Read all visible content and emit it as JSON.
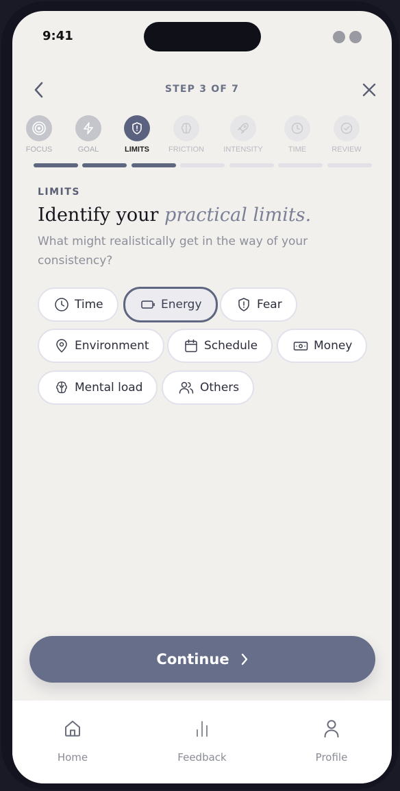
{
  "status_bar": {
    "time": "9:41"
  },
  "header": {
    "step_text": "STEP 3 OF 7"
  },
  "steps": [
    {
      "label": "FOCUS",
      "state": "done",
      "icon": "target-icon"
    },
    {
      "label": "GOAL",
      "state": "done",
      "icon": "bolt-icon"
    },
    {
      "label": "LIMITS",
      "state": "active",
      "icon": "shield-alert-icon"
    },
    {
      "label": "FRICTION",
      "state": "todo",
      "icon": "brain-icon"
    },
    {
      "label": "INTENSITY",
      "state": "todo",
      "icon": "rocket-icon"
    },
    {
      "label": "TIME",
      "state": "todo",
      "icon": "clock-icon"
    },
    {
      "label": "REVIEW",
      "state": "todo",
      "icon": "check-circle-icon"
    }
  ],
  "progress": {
    "completed_segments": 3,
    "total_segments": 7
  },
  "content": {
    "eyebrow": "LIMITS",
    "headline_plain": "Identify your",
    "headline_emphasis": "practical limits.",
    "subtitle": "What might realistically get in the way of your consistency?"
  },
  "chips": [
    {
      "label": "Time",
      "icon": "clock-icon",
      "selected": false
    },
    {
      "label": "Energy",
      "icon": "battery-icon",
      "selected": true
    },
    {
      "label": "Fear",
      "icon": "shield-alert-icon",
      "selected": false
    },
    {
      "label": "Environment",
      "icon": "map-pin-icon",
      "selected": false
    },
    {
      "label": "Schedule",
      "icon": "calendar-icon",
      "selected": false
    },
    {
      "label": "Money",
      "icon": "banknote-icon",
      "selected": false
    },
    {
      "label": "Mental load",
      "icon": "brain-icon",
      "selected": false
    },
    {
      "label": "Others",
      "icon": "users-icon",
      "selected": false
    }
  ],
  "cta": {
    "label": "Continue"
  },
  "tabbar": [
    {
      "label": "Home",
      "icon": "home-icon"
    },
    {
      "label": "Feedback",
      "icon": "bar-chart-icon"
    },
    {
      "label": "Profile",
      "icon": "user-icon"
    }
  ],
  "colors": {
    "accent": "#666e8a",
    "background": "#f2f0ed"
  }
}
